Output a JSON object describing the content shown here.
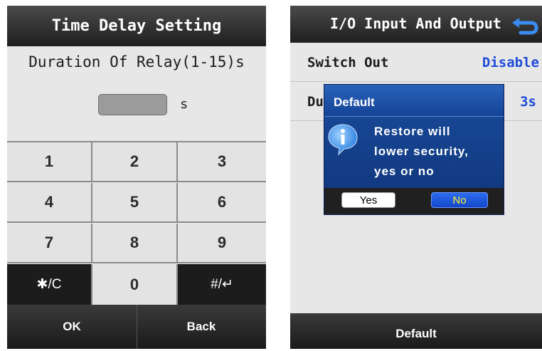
{
  "left_screen": {
    "title": "Time Delay Setting",
    "prompt": "Duration Of Relay(1-15)s",
    "input_value": "",
    "unit": "s",
    "keys": [
      "1",
      "2",
      "3",
      "4",
      "5",
      "6",
      "7",
      "8",
      "9",
      "✱/C",
      "0",
      "#/↵"
    ],
    "ok_label": "OK",
    "back_label": "Back"
  },
  "right_screen": {
    "title": "I/O Input And Output",
    "back_icon": "return-arrow-icon",
    "rows": [
      {
        "label": "Switch Out",
        "value": "Disable"
      },
      {
        "label": "Du",
        "value": "3s"
      }
    ],
    "dialog": {
      "title": "Default",
      "icon": "info-icon",
      "message_lines": [
        "Restore will",
        "lower security,",
        "yes or no"
      ],
      "yes_label": "Yes",
      "no_label": "No"
    },
    "bottom_label": "Default"
  },
  "colors": {
    "title_bar": "#2b2b2b",
    "screen_bg": "#e7e7e7",
    "value_blue": "#1f4cd8",
    "dialog_blue": "#1a4c9c",
    "no_button": "#1f5fe8",
    "no_text": "#ffee33"
  }
}
